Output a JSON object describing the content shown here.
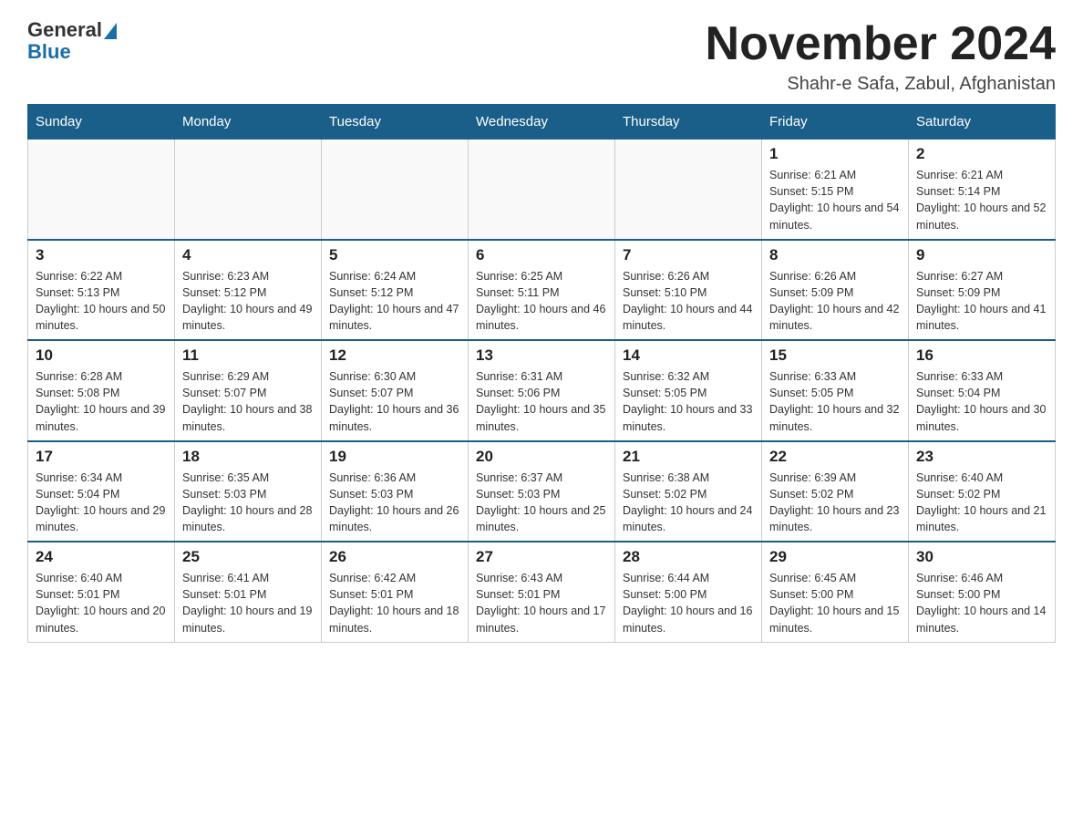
{
  "header": {
    "logo_general": "General",
    "logo_blue": "Blue",
    "month_title": "November 2024",
    "location": "Shahr-e Safa, Zabul, Afghanistan"
  },
  "weekdays": [
    "Sunday",
    "Monday",
    "Tuesday",
    "Wednesday",
    "Thursday",
    "Friday",
    "Saturday"
  ],
  "weeks": [
    [
      {
        "day": "",
        "info": ""
      },
      {
        "day": "",
        "info": ""
      },
      {
        "day": "",
        "info": ""
      },
      {
        "day": "",
        "info": ""
      },
      {
        "day": "",
        "info": ""
      },
      {
        "day": "1",
        "info": "Sunrise: 6:21 AM\nSunset: 5:15 PM\nDaylight: 10 hours and 54 minutes."
      },
      {
        "day": "2",
        "info": "Sunrise: 6:21 AM\nSunset: 5:14 PM\nDaylight: 10 hours and 52 minutes."
      }
    ],
    [
      {
        "day": "3",
        "info": "Sunrise: 6:22 AM\nSunset: 5:13 PM\nDaylight: 10 hours and 50 minutes."
      },
      {
        "day": "4",
        "info": "Sunrise: 6:23 AM\nSunset: 5:12 PM\nDaylight: 10 hours and 49 minutes."
      },
      {
        "day": "5",
        "info": "Sunrise: 6:24 AM\nSunset: 5:12 PM\nDaylight: 10 hours and 47 minutes."
      },
      {
        "day": "6",
        "info": "Sunrise: 6:25 AM\nSunset: 5:11 PM\nDaylight: 10 hours and 46 minutes."
      },
      {
        "day": "7",
        "info": "Sunrise: 6:26 AM\nSunset: 5:10 PM\nDaylight: 10 hours and 44 minutes."
      },
      {
        "day": "8",
        "info": "Sunrise: 6:26 AM\nSunset: 5:09 PM\nDaylight: 10 hours and 42 minutes."
      },
      {
        "day": "9",
        "info": "Sunrise: 6:27 AM\nSunset: 5:09 PM\nDaylight: 10 hours and 41 minutes."
      }
    ],
    [
      {
        "day": "10",
        "info": "Sunrise: 6:28 AM\nSunset: 5:08 PM\nDaylight: 10 hours and 39 minutes."
      },
      {
        "day": "11",
        "info": "Sunrise: 6:29 AM\nSunset: 5:07 PM\nDaylight: 10 hours and 38 minutes."
      },
      {
        "day": "12",
        "info": "Sunrise: 6:30 AM\nSunset: 5:07 PM\nDaylight: 10 hours and 36 minutes."
      },
      {
        "day": "13",
        "info": "Sunrise: 6:31 AM\nSunset: 5:06 PM\nDaylight: 10 hours and 35 minutes."
      },
      {
        "day": "14",
        "info": "Sunrise: 6:32 AM\nSunset: 5:05 PM\nDaylight: 10 hours and 33 minutes."
      },
      {
        "day": "15",
        "info": "Sunrise: 6:33 AM\nSunset: 5:05 PM\nDaylight: 10 hours and 32 minutes."
      },
      {
        "day": "16",
        "info": "Sunrise: 6:33 AM\nSunset: 5:04 PM\nDaylight: 10 hours and 30 minutes."
      }
    ],
    [
      {
        "day": "17",
        "info": "Sunrise: 6:34 AM\nSunset: 5:04 PM\nDaylight: 10 hours and 29 minutes."
      },
      {
        "day": "18",
        "info": "Sunrise: 6:35 AM\nSunset: 5:03 PM\nDaylight: 10 hours and 28 minutes."
      },
      {
        "day": "19",
        "info": "Sunrise: 6:36 AM\nSunset: 5:03 PM\nDaylight: 10 hours and 26 minutes."
      },
      {
        "day": "20",
        "info": "Sunrise: 6:37 AM\nSunset: 5:03 PM\nDaylight: 10 hours and 25 minutes."
      },
      {
        "day": "21",
        "info": "Sunrise: 6:38 AM\nSunset: 5:02 PM\nDaylight: 10 hours and 24 minutes."
      },
      {
        "day": "22",
        "info": "Sunrise: 6:39 AM\nSunset: 5:02 PM\nDaylight: 10 hours and 23 minutes."
      },
      {
        "day": "23",
        "info": "Sunrise: 6:40 AM\nSunset: 5:02 PM\nDaylight: 10 hours and 21 minutes."
      }
    ],
    [
      {
        "day": "24",
        "info": "Sunrise: 6:40 AM\nSunset: 5:01 PM\nDaylight: 10 hours and 20 minutes."
      },
      {
        "day": "25",
        "info": "Sunrise: 6:41 AM\nSunset: 5:01 PM\nDaylight: 10 hours and 19 minutes."
      },
      {
        "day": "26",
        "info": "Sunrise: 6:42 AM\nSunset: 5:01 PM\nDaylight: 10 hours and 18 minutes."
      },
      {
        "day": "27",
        "info": "Sunrise: 6:43 AM\nSunset: 5:01 PM\nDaylight: 10 hours and 17 minutes."
      },
      {
        "day": "28",
        "info": "Sunrise: 6:44 AM\nSunset: 5:00 PM\nDaylight: 10 hours and 16 minutes."
      },
      {
        "day": "29",
        "info": "Sunrise: 6:45 AM\nSunset: 5:00 PM\nDaylight: 10 hours and 15 minutes."
      },
      {
        "day": "30",
        "info": "Sunrise: 6:46 AM\nSunset: 5:00 PM\nDaylight: 10 hours and 14 minutes."
      }
    ]
  ]
}
